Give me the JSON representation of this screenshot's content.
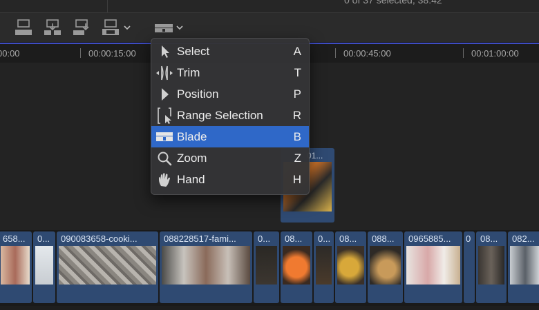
{
  "topbar": {
    "status_text": "0 of 37 selected, 38:42"
  },
  "toolbar": {
    "buttons": [
      "connect-clip-icon",
      "insert-clip-icon",
      "append-clip-icon",
      "overwrite-clip-icon"
    ],
    "tool_selector_icon": "blade-icon"
  },
  "ruler": {
    "labels": [
      "00:00",
      "00:00:15:00",
      "00:00:45:00",
      "00:01:00:00"
    ]
  },
  "tools_menu": {
    "items": [
      {
        "label": "Select",
        "shortcut": "A",
        "icon": "arrow-icon",
        "selected": false
      },
      {
        "label": "Trim",
        "shortcut": "T",
        "icon": "trim-icon",
        "selected": false
      },
      {
        "label": "Position",
        "shortcut": "P",
        "icon": "position-icon",
        "selected": false
      },
      {
        "label": "Range Selection",
        "shortcut": "R",
        "icon": "range-selection-icon",
        "selected": false
      },
      {
        "label": "Blade",
        "shortcut": "B",
        "icon": "blade-icon",
        "selected": true
      },
      {
        "label": "Zoom",
        "shortcut": "Z",
        "icon": "zoom-icon",
        "selected": false
      },
      {
        "label": "Hand",
        "shortcut": "H",
        "icon": "hand-icon",
        "selected": false
      }
    ]
  },
  "connected_clip": {
    "label": "01..."
  },
  "clips": [
    {
      "label": "658..."
    },
    {
      "label": "0..."
    },
    {
      "label": "090083658-cooki..."
    },
    {
      "label": "088228517-fami..."
    },
    {
      "label": "0..."
    },
    {
      "label": "08..."
    },
    {
      "label": "0..."
    },
    {
      "label": "08..."
    },
    {
      "label": "088..."
    },
    {
      "label": "0965885..."
    },
    {
      "label": "0"
    },
    {
      "label": "08..."
    },
    {
      "label": "082..."
    }
  ],
  "colors": {
    "accent": "#2f68c8",
    "clip_blue": "#2f4a72",
    "playhead_line": "#3e4cc4"
  }
}
